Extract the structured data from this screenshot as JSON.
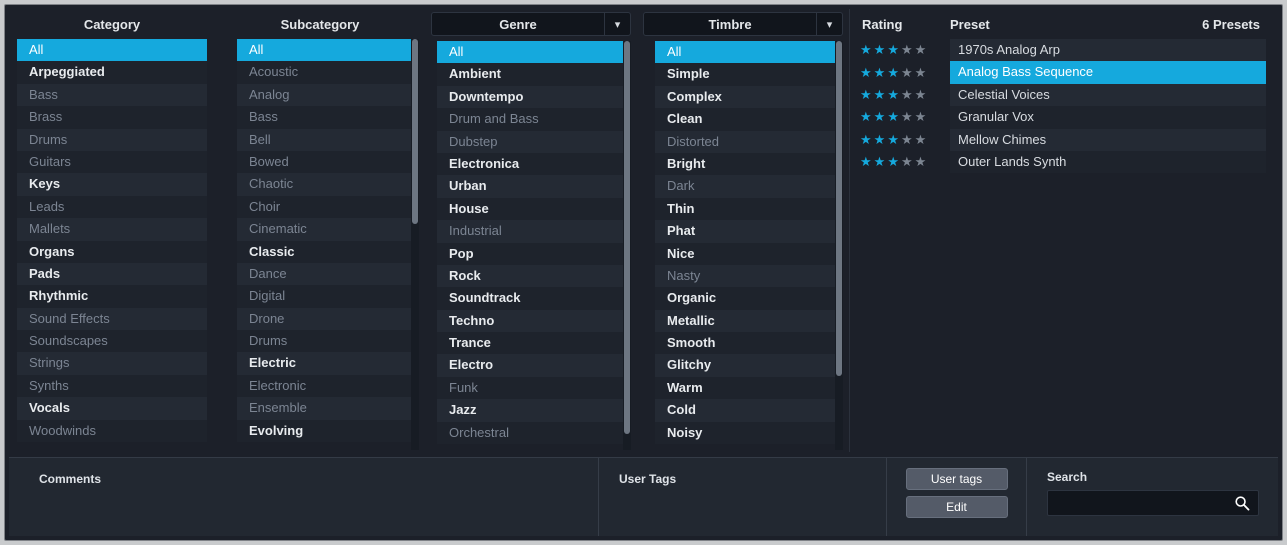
{
  "columns": {
    "category": {
      "header": "Category",
      "items": [
        {
          "label": "All",
          "state": "selected"
        },
        {
          "label": "Arpeggiated",
          "state": "on"
        },
        {
          "label": "Bass",
          "state": "off"
        },
        {
          "label": "Brass",
          "state": "off"
        },
        {
          "label": "Drums",
          "state": "off"
        },
        {
          "label": "Guitars",
          "state": "off"
        },
        {
          "label": "Keys",
          "state": "on"
        },
        {
          "label": "Leads",
          "state": "off"
        },
        {
          "label": "Mallets",
          "state": "off"
        },
        {
          "label": "Organs",
          "state": "on"
        },
        {
          "label": "Pads",
          "state": "on"
        },
        {
          "label": "Rhythmic",
          "state": "on"
        },
        {
          "label": "Sound Effects",
          "state": "off"
        },
        {
          "label": "Soundscapes",
          "state": "off"
        },
        {
          "label": "Strings",
          "state": "off"
        },
        {
          "label": "Synths",
          "state": "off"
        },
        {
          "label": "Vocals",
          "state": "on"
        },
        {
          "label": "Woodwinds",
          "state": "off"
        }
      ]
    },
    "subcategory": {
      "header": "Subcategory",
      "scrollbar": {
        "thumb_top_pct": 0,
        "thumb_height_pct": 45
      },
      "items": [
        {
          "label": "All",
          "state": "selected"
        },
        {
          "label": "Acoustic",
          "state": "off"
        },
        {
          "label": "Analog",
          "state": "off"
        },
        {
          "label": "Bass",
          "state": "off"
        },
        {
          "label": "Bell",
          "state": "off"
        },
        {
          "label": "Bowed",
          "state": "off"
        },
        {
          "label": "Chaotic",
          "state": "off"
        },
        {
          "label": "Choir",
          "state": "off"
        },
        {
          "label": "Cinematic",
          "state": "off"
        },
        {
          "label": "Classic",
          "state": "on"
        },
        {
          "label": "Dance",
          "state": "off"
        },
        {
          "label": "Digital",
          "state": "off"
        },
        {
          "label": "Drone",
          "state": "off"
        },
        {
          "label": "Drums",
          "state": "off"
        },
        {
          "label": "Electric",
          "state": "on"
        },
        {
          "label": "Electronic",
          "state": "off"
        },
        {
          "label": "Ensemble",
          "state": "off"
        },
        {
          "label": "Evolving",
          "state": "on"
        }
      ]
    },
    "genre": {
      "header": "Genre",
      "dropdown_icon": "chevron-down-icon",
      "scrollbar": {
        "thumb_top_pct": 0,
        "thumb_height_pct": 96
      },
      "items": [
        {
          "label": "All",
          "state": "selected"
        },
        {
          "label": "Ambient",
          "state": "on"
        },
        {
          "label": "Downtempo",
          "state": "on"
        },
        {
          "label": "Drum and Bass",
          "state": "off"
        },
        {
          "label": "Dubstep",
          "state": "off"
        },
        {
          "label": "Electronica",
          "state": "on"
        },
        {
          "label": "Urban",
          "state": "on"
        },
        {
          "label": "House",
          "state": "on"
        },
        {
          "label": "Industrial",
          "state": "off"
        },
        {
          "label": "Pop",
          "state": "on"
        },
        {
          "label": "Rock",
          "state": "on"
        },
        {
          "label": "Soundtrack",
          "state": "on"
        },
        {
          "label": "Techno",
          "state": "on"
        },
        {
          "label": "Trance",
          "state": "on"
        },
        {
          "label": "Electro",
          "state": "on"
        },
        {
          "label": "Funk",
          "state": "off"
        },
        {
          "label": "Jazz",
          "state": "on"
        },
        {
          "label": "Orchestral",
          "state": "off"
        }
      ]
    },
    "timbre": {
      "header": "Timbre",
      "dropdown_icon": "chevron-down-icon",
      "scrollbar": {
        "thumb_top_pct": 0,
        "thumb_height_pct": 82
      },
      "items": [
        {
          "label": "All",
          "state": "selected"
        },
        {
          "label": "Simple",
          "state": "on"
        },
        {
          "label": "Complex",
          "state": "on"
        },
        {
          "label": "Clean",
          "state": "on"
        },
        {
          "label": "Distorted",
          "state": "off"
        },
        {
          "label": "Bright",
          "state": "on"
        },
        {
          "label": "Dark",
          "state": "off"
        },
        {
          "label": "Thin",
          "state": "on"
        },
        {
          "label": "Phat",
          "state": "on"
        },
        {
          "label": "Nice",
          "state": "on"
        },
        {
          "label": "Nasty",
          "state": "off"
        },
        {
          "label": "Organic",
          "state": "on"
        },
        {
          "label": "Metallic",
          "state": "on"
        },
        {
          "label": "Smooth",
          "state": "on"
        },
        {
          "label": "Glitchy",
          "state": "on"
        },
        {
          "label": "Warm",
          "state": "on"
        },
        {
          "label": "Cold",
          "state": "on"
        },
        {
          "label": "Noisy",
          "state": "on"
        }
      ]
    }
  },
  "presets": {
    "header": {
      "rating": "Rating",
      "preset": "Preset",
      "count": "6 Presets"
    },
    "max_stars": 5,
    "items": [
      {
        "name": "1970s Analog Arp",
        "rating": 3,
        "selected": false
      },
      {
        "name": "Analog Bass Sequence",
        "rating": 3,
        "selected": true
      },
      {
        "name": "Celestial Voices",
        "rating": 3,
        "selected": false
      },
      {
        "name": "Granular Vox",
        "rating": 3,
        "selected": false
      },
      {
        "name": "Mellow Chimes",
        "rating": 3,
        "selected": false
      },
      {
        "name": "Outer Lands Synth",
        "rating": 3,
        "selected": false
      }
    ]
  },
  "bottom": {
    "comments_label": "Comments",
    "comments_value": "",
    "user_tags_label": "User Tags",
    "user_tags_value": "",
    "user_tags_button": "User tags",
    "edit_button": "Edit",
    "search_label": "Search",
    "search_value": "",
    "search_placeholder": "",
    "search_icon": "search-icon"
  },
  "colors": {
    "accent": "#15a9dd",
    "panel_bg": "#1c2029",
    "row_odd": "#242a34",
    "row_even": "#1e232c",
    "text_on": "#e8ebee",
    "text_off": "#7c8593",
    "star_full": "#15a9dd",
    "star_empty": "#7c8591"
  }
}
